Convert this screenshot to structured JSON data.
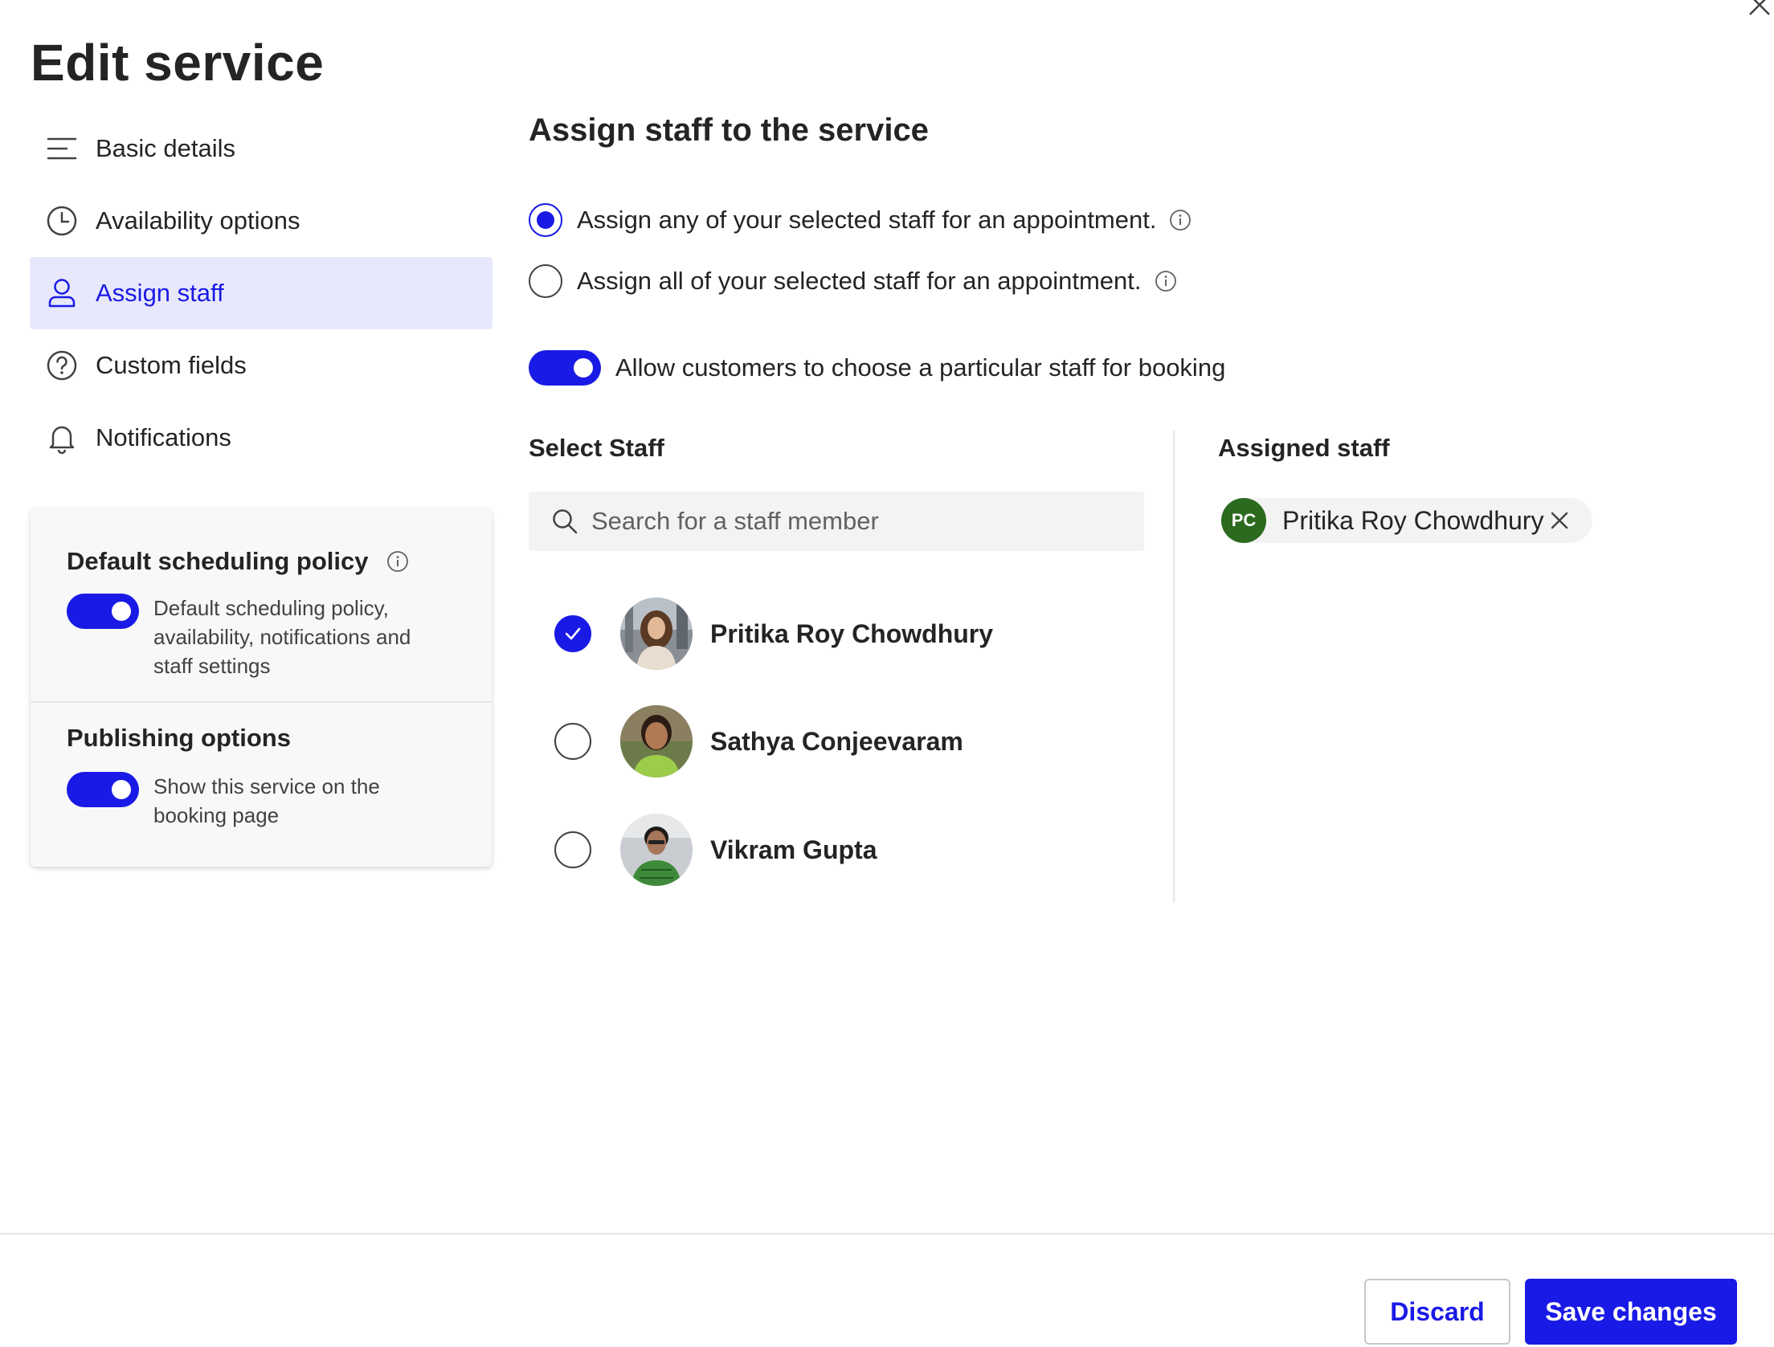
{
  "dialog": {
    "title": "Edit service"
  },
  "nav": {
    "items": [
      {
        "label": "Basic details",
        "icon": "list-icon"
      },
      {
        "label": "Availability options",
        "icon": "clock-icon"
      },
      {
        "label": "Assign staff",
        "icon": "person-icon",
        "active": true
      },
      {
        "label": "Custom fields",
        "icon": "question-icon"
      },
      {
        "label": "Notifications",
        "icon": "bell-icon"
      }
    ]
  },
  "policy_card": {
    "default_policy": {
      "title": "Default scheduling policy",
      "toggle_on": true,
      "description": "Default scheduling policy, availability, notifications and staff settings"
    },
    "publishing": {
      "title": "Publishing options",
      "toggle_on": true,
      "description": "Show this service on the booking page"
    }
  },
  "main": {
    "heading": "Assign staff to the service",
    "radio_any": {
      "label": "Assign any of your selected staff for an appointment.",
      "selected": true
    },
    "radio_all": {
      "label": "Assign all of your selected staff for an appointment.",
      "selected": false
    },
    "allow_toggle": {
      "label": "Allow customers to choose a particular staff for booking",
      "on": true
    },
    "select_staff": {
      "label": "Select Staff",
      "search_placeholder": "Search for a staff member",
      "staff": [
        {
          "name": "Pritika Roy Chowdhury",
          "checked": true
        },
        {
          "name": "Sathya Conjeevaram",
          "checked": false
        },
        {
          "name": "Vikram Gupta",
          "checked": false
        }
      ]
    },
    "assigned_staff": {
      "label": "Assigned staff",
      "chips": [
        {
          "initials": "PC",
          "name": "Pritika Roy Chowdhury"
        }
      ]
    }
  },
  "footer": {
    "discard_label": "Discard",
    "save_label": "Save changes"
  },
  "colors": {
    "accent": "#1a1ae6",
    "nav_active_bg": "#e8e8fc",
    "chip_avatar": "#2b6a1f"
  }
}
